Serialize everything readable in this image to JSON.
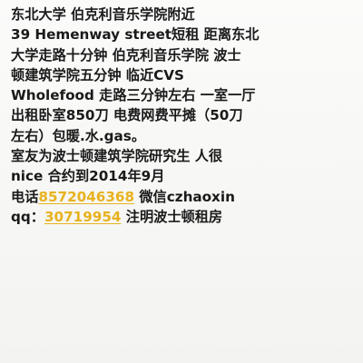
{
  "note": {
    "lines": [
      "东北大学 伯克利音乐学院附近",
      "39 Hemenway street短租 距离东北",
      "大学走路十分钟 伯克利音乐学院 波士",
      "顿建筑学院五分钟 临近CVS",
      "Wholefood 走路三分钟左右 一室一厅",
      "出租卧室850刀 电费网费平摊（50刀",
      "左右）包暖.水.gas。",
      "室友为波士顿建筑学院研究生 人很",
      "nice 合约到2014年9月"
    ],
    "phone_label": "电话",
    "phone_number": "8572046368",
    "wechat_text": " 微信czhaoxin",
    "qq_label": "qq：",
    "qq_number": "30719954",
    "qq_note": " 注明波士顿租房"
  },
  "colors": {
    "link": "#e8b21f",
    "text": "#1a1a1a",
    "background": "#f7f7f5"
  }
}
